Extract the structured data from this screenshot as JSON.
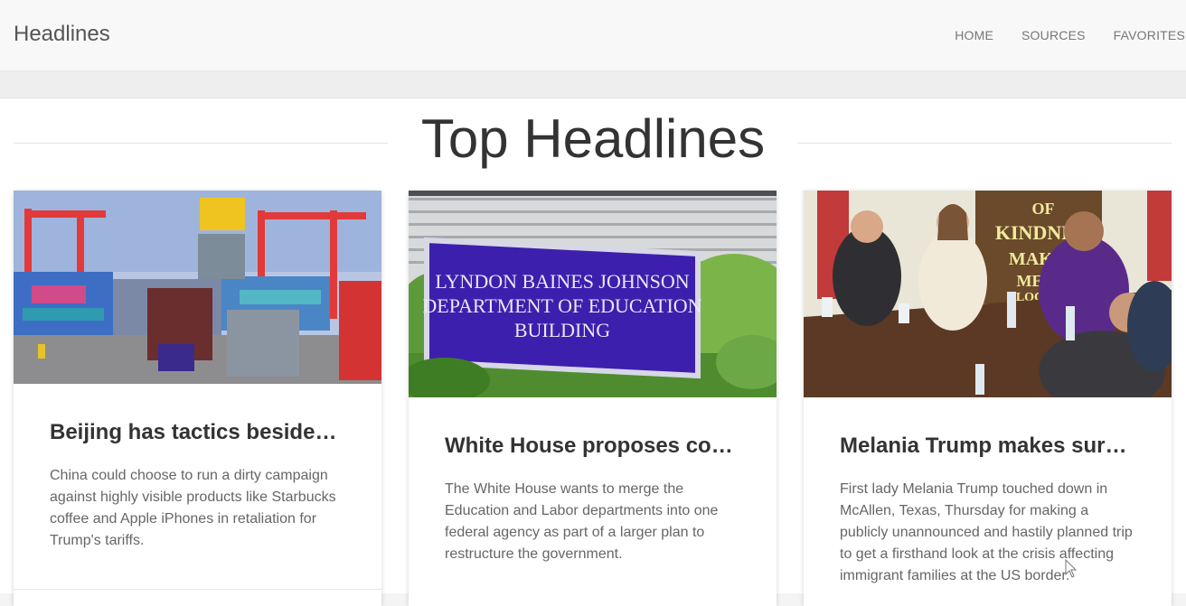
{
  "nav": {
    "brand": "Headlines",
    "links": [
      "HOME",
      "SOURCES",
      "FAVORITES"
    ]
  },
  "page": {
    "title": "Top Headlines"
  },
  "cards": [
    {
      "title": "Beijing has tactics besides j…",
      "description": "China could choose to run a dirty campaign against highly visible products like Starbucks coffee and Apple iPhones in retaliation for Trump's tariffs.",
      "image": "shipping-containers-port-photo"
    },
    {
      "title": "White House proposes com…",
      "description": "The White House wants to merge the Education and Labor departments into one federal agency as part of a larger plan to restructure the government.",
      "image": "department-of-education-sign-photo",
      "image_sign": [
        "LYNDON BAINES JOHNSON",
        "DEPARTMENT OF EDUCATION",
        "BUILDING"
      ]
    },
    {
      "title": "Melania Trump makes surpr…",
      "description": "First lady Melania Trump touched down in McAllen, Texas, Thursday for making a publicly unannounced and hastily planned trip to get a firsthand look at the crisis affecting immigrant families at the US border.",
      "image": "roundtable-meeting-photo",
      "image_poster": [
        "OF",
        "KINDNES",
        "MAKE",
        "ME",
        "LOC"
      ]
    }
  ]
}
